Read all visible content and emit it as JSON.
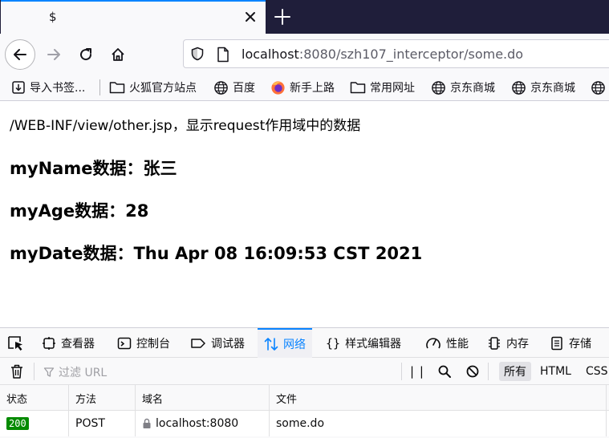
{
  "browser": {
    "tab": {
      "title": "$"
    },
    "url": {
      "host": "localhost",
      "path": ":8080/szh107_interceptor/some.do"
    },
    "bookmarks": [
      {
        "label": "导入书签...",
        "icon": "import-icon"
      },
      {
        "label": "火狐官方站点",
        "icon": "folder-icon"
      },
      {
        "label": "百度",
        "icon": "globe-icon"
      },
      {
        "label": "新手上路",
        "icon": "firefox-icon"
      },
      {
        "label": "常用网址",
        "icon": "folder-icon"
      },
      {
        "label": "京东商城",
        "icon": "globe-icon"
      },
      {
        "label": "京东商城",
        "icon": "globe-icon"
      }
    ]
  },
  "page": {
    "line1": "/WEB-INF/view/other.jsp，显示request作用域中的数据",
    "name_line": "myName数据：张三",
    "age_line": "myAge数据：28",
    "date_line": "myDate数据：Thu Apr 08 16:09:53 CST 2021"
  },
  "devtools": {
    "tabs": [
      {
        "label": "查看器",
        "icon": "inspector-icon"
      },
      {
        "label": "控制台",
        "icon": "console-icon"
      },
      {
        "label": "调试器",
        "icon": "debugger-icon"
      },
      {
        "label": "网络",
        "icon": "network-icon",
        "active": true
      },
      {
        "label": "样式编辑器",
        "icon": "style-editor-icon"
      },
      {
        "label": "性能",
        "icon": "performance-icon"
      },
      {
        "label": "内存",
        "icon": "memory-icon"
      },
      {
        "label": "存储",
        "icon": "storage-icon"
      }
    ],
    "filter_placeholder": "过滤 URL",
    "pause_label": "| |",
    "type_filters": [
      "所有",
      "HTML",
      "CSS"
    ],
    "columns": [
      "状态",
      "方法",
      "域名",
      "文件"
    ],
    "rows": [
      {
        "status": "200",
        "method": "POST",
        "domain": "localhost:8080",
        "file": "some.do"
      }
    ]
  },
  "colors": {
    "accent": "#0a84ff",
    "tabstrip": "#1f1e3a",
    "status_ok": "#058b00"
  }
}
